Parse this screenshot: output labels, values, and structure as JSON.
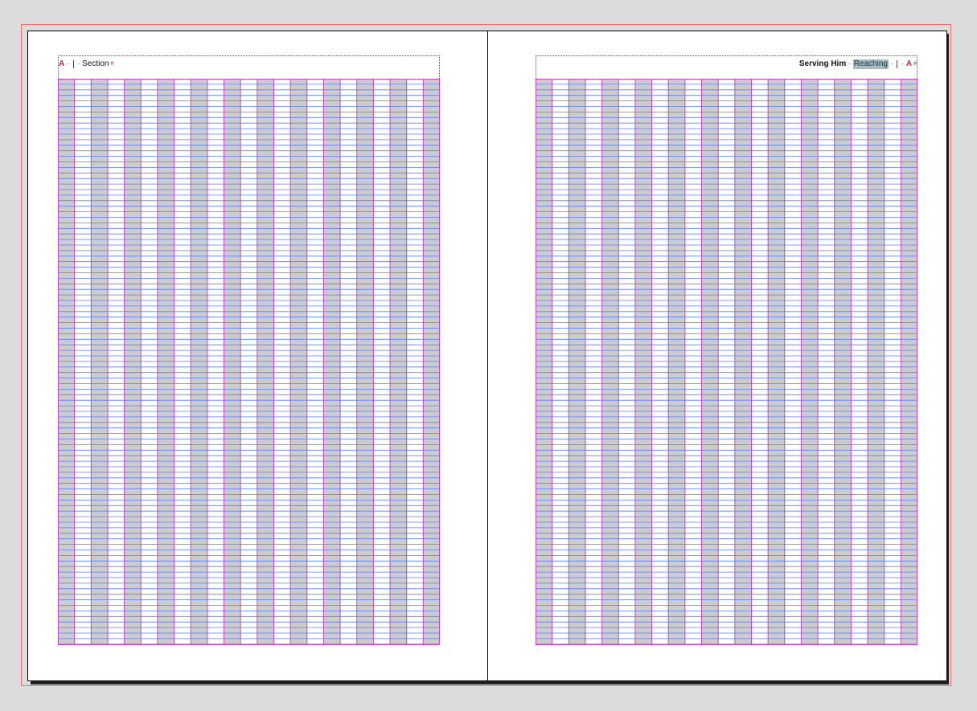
{
  "left_page": {
    "marker": "A",
    "dash_1": "–",
    "dash_2": "–",
    "section_label": "Section",
    "end_mark": "#"
  },
  "right_page": {
    "title": "Serving Him",
    "dash_1": "–",
    "highlighted_label": "Reaching",
    "dash_2": "–",
    "dash_3": "–",
    "marker": "A",
    "end_mark": "#"
  },
  "colors": {
    "canvas": "#dcdcdc",
    "page": "#ffffff",
    "column_shade": "#cccccc",
    "column_guide": "#cc44cc",
    "baseline_guide": "#5a7cff",
    "bleed_guide": "#f07070",
    "marker": "#e02020",
    "highlight": "#a8bcc4"
  },
  "grid": {
    "columns": 23,
    "shaded_columns": "alternate-starting-first"
  }
}
